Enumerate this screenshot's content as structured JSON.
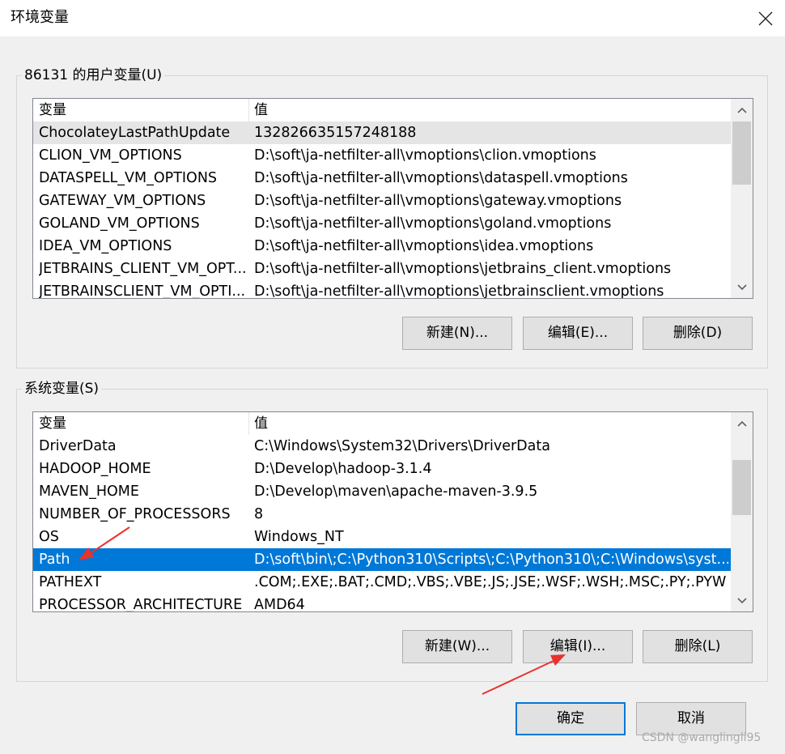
{
  "window": {
    "title": "环境变量",
    "close_icon": "close-icon"
  },
  "user_vars": {
    "group_label": "86131 的用户变量(U)",
    "columns": [
      "变量",
      "值"
    ],
    "rows": [
      {
        "name": "ChocolateyLastPathUpdate",
        "value": "132826635157248188"
      },
      {
        "name": "CLION_VM_OPTIONS",
        "value": "D:\\soft\\ja-netfilter-all\\vmoptions\\clion.vmoptions"
      },
      {
        "name": "DATASPELL_VM_OPTIONS",
        "value": "D:\\soft\\ja-netfilter-all\\vmoptions\\dataspell.vmoptions"
      },
      {
        "name": "GATEWAY_VM_OPTIONS",
        "value": "D:\\soft\\ja-netfilter-all\\vmoptions\\gateway.vmoptions"
      },
      {
        "name": "GOLAND_VM_OPTIONS",
        "value": "D:\\soft\\ja-netfilter-all\\vmoptions\\goland.vmoptions"
      },
      {
        "name": "IDEA_VM_OPTIONS",
        "value": "D:\\soft\\ja-netfilter-all\\vmoptions\\idea.vmoptions"
      },
      {
        "name": "JETBRAINS_CLIENT_VM_OPT...",
        "value": "D:\\soft\\ja-netfilter-all\\vmoptions\\jetbrains_client.vmoptions"
      },
      {
        "name": "JETBRAINSCLIENT_VM_OPTI...",
        "value": "D:\\soft\\ja-netfilter-all\\vmoptions\\jetbrainsclient.vmoptions"
      }
    ],
    "buttons": {
      "new": "新建(N)...",
      "edit": "编辑(E)...",
      "delete": "删除(D)"
    }
  },
  "system_vars": {
    "group_label": "系统变量(S)",
    "columns": [
      "变量",
      "值"
    ],
    "rows": [
      {
        "name": "DriverData",
        "value": "C:\\Windows\\System32\\Drivers\\DriverData"
      },
      {
        "name": "HADOOP_HOME",
        "value": "D:\\Develop\\hadoop-3.1.4"
      },
      {
        "name": "MAVEN_HOME",
        "value": "D:\\Develop\\maven\\apache-maven-3.9.5"
      },
      {
        "name": "NUMBER_OF_PROCESSORS",
        "value": "8"
      },
      {
        "name": "OS",
        "value": "Windows_NT"
      },
      {
        "name": "Path",
        "value": "D:\\soft\\bin\\;C:\\Python310\\Scripts\\;C:\\Python310\\;C:\\Windows\\syst..."
      },
      {
        "name": "PATHEXT",
        "value": ".COM;.EXE;.BAT;.CMD;.VBS;.VBE;.JS;.JSE;.WSF;.WSH;.MSC;.PY;.PYW"
      },
      {
        "name": "PROCESSOR_ARCHITECTURE",
        "value": "AMD64"
      }
    ],
    "selected_row": "Path",
    "buttons": {
      "new": "新建(W)...",
      "edit": "编辑(I)...",
      "delete": "删除(L)"
    }
  },
  "footer": {
    "ok": "确定",
    "cancel": "取消"
  },
  "annotation_color": "#e8322c",
  "watermark": "CSDN @wanglingli95"
}
